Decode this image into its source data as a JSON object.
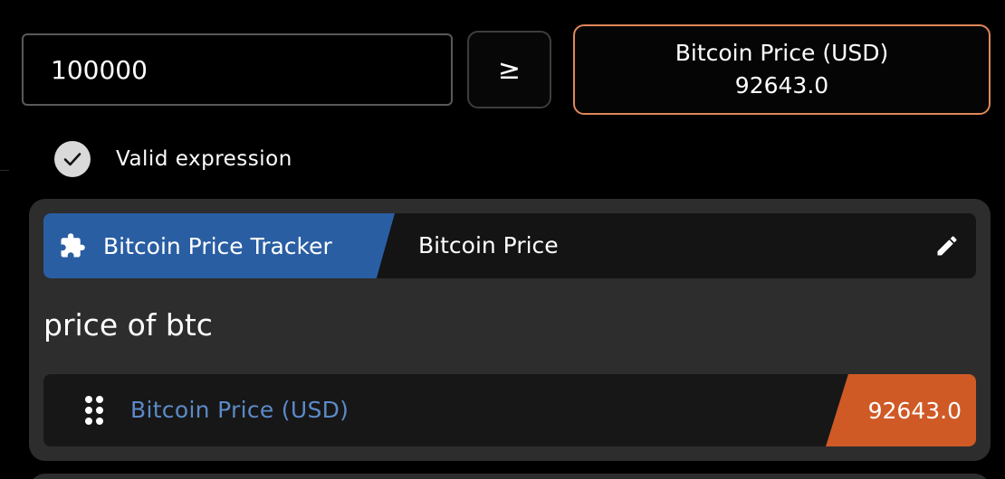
{
  "condition": {
    "input_value": "100000",
    "operator_label": "≥",
    "result": {
      "label": "Bitcoin Price (USD)",
      "value": "92643.0"
    }
  },
  "validation": {
    "text": "Valid expression",
    "icon": "check-icon"
  },
  "block": {
    "plugin_name": "Bitcoin Price Tracker",
    "plugin_icon": "puzzle-icon",
    "title": "Bitcoin Price",
    "edit_icon": "pencil-icon",
    "description": "price of btc",
    "output": {
      "handle_icon": "drag-handle-icon",
      "label": "Bitcoin Price (USD)",
      "value": "92643.0"
    }
  },
  "colors": {
    "plugin_tag": "#2a5ea3",
    "output_value_tag": "#cf5a26",
    "result_border": "#e0875a",
    "output_label": "#5b8ac8"
  }
}
